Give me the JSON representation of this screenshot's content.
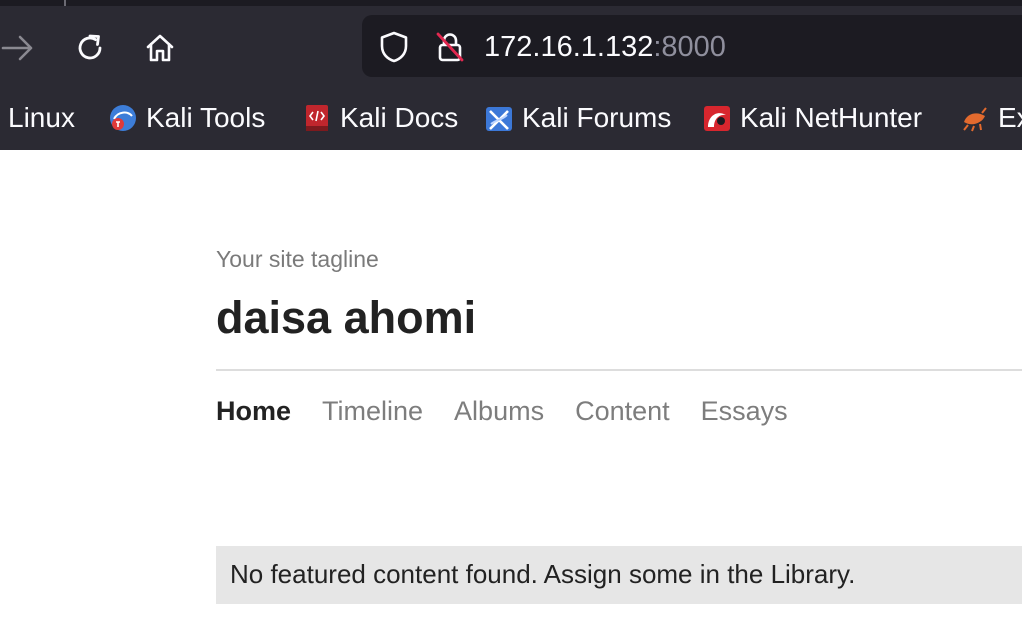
{
  "browser": {
    "url_host": "172.16.1.132",
    "url_port": ":8000",
    "bookmarks": [
      {
        "label": "i Linux",
        "icon": "kali-linux-icon"
      },
      {
        "label": "Kali Tools",
        "icon": "kali-tools-icon"
      },
      {
        "label": "Kali Docs",
        "icon": "kali-docs-icon"
      },
      {
        "label": "Kali Forums",
        "icon": "kali-forums-icon"
      },
      {
        "label": "Kali NetHunter",
        "icon": "kali-nethunter-icon"
      },
      {
        "label": "Ex",
        "icon": "exploit-db-icon"
      }
    ],
    "colors": {
      "chrome": "#2b2a33",
      "urlbar": "#1c1b22",
      "text": "#fbfbfe"
    }
  },
  "site": {
    "tagline": "Your site tagline",
    "title": "daisa ahomi",
    "nav": [
      {
        "label": "Home",
        "active": true
      },
      {
        "label": "Timeline"
      },
      {
        "label": "Albums"
      },
      {
        "label": "Content"
      },
      {
        "label": "Essays"
      }
    ],
    "notice": "No featured content found. Assign some in the Library."
  }
}
